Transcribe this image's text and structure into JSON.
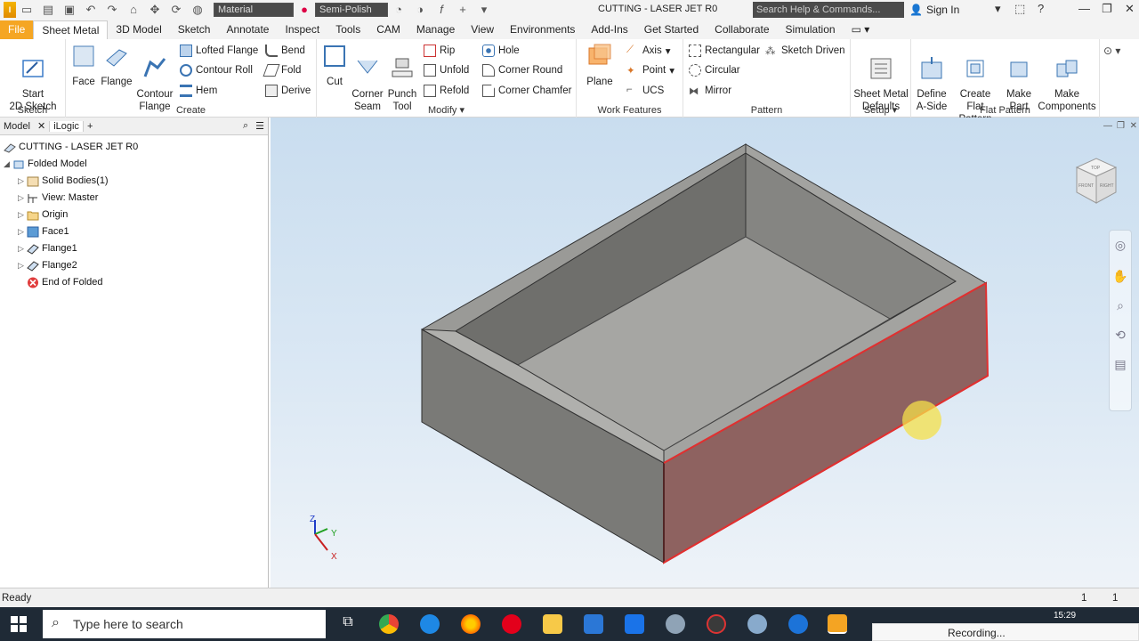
{
  "app": {
    "title": "CUTTING - LASER JET R0",
    "material_placeholder": "Material",
    "appearance": "Semi-Polish",
    "search_placeholder": "Search Help & Commands...",
    "signin": "Sign In"
  },
  "tabs": [
    "File",
    "Sheet Metal",
    "3D Model",
    "Sketch",
    "Annotate",
    "Inspect",
    "Tools",
    "CAM",
    "Manage",
    "View",
    "Environments",
    "Add-Ins",
    "Get Started",
    "Collaborate",
    "Simulation"
  ],
  "ribbon": {
    "sketch": {
      "title": "Sketch",
      "start_2d": "Start\n2D Sketch"
    },
    "create": {
      "title": "Create",
      "face": "Face",
      "flange": "Flange",
      "contour_flange": "Contour\nFlange",
      "lofted_flange": "Lofted Flange",
      "contour_roll": "Contour Roll",
      "hem": "Hem",
      "bend": "Bend",
      "fold": "Fold",
      "derive": "Derive"
    },
    "modify": {
      "title": "Modify",
      "cut": "Cut",
      "corner_seam": "Corner\nSeam",
      "punch_tool": "Punch\nTool",
      "rip": "Rip",
      "unfold": "Unfold",
      "refold": "Refold",
      "hole": "Hole",
      "corner_round": "Corner Round",
      "corner_chamfer": "Corner Chamfer"
    },
    "work_features": {
      "title": "Work Features",
      "plane": "Plane",
      "axis": "Axis",
      "point": "Point",
      "ucs": "UCS"
    },
    "pattern": {
      "title": "Pattern",
      "rectangular": "Rectangular",
      "circular": "Circular",
      "mirror": "Mirror",
      "sketch_driven": "Sketch Driven"
    },
    "setup": {
      "title": "Setup",
      "defaults": "Sheet Metal\nDefaults"
    },
    "flat_pattern": {
      "title": "Flat Pattern",
      "define_a_side": "Define\nA-Side",
      "create_flat": "Create\nFlat Pattern",
      "make_part": "Make\nPart",
      "make_components": "Make\nComponents"
    }
  },
  "browser": {
    "tab_model": "Model",
    "tab_ilogic": "iLogic",
    "root": "CUTTING - LASER JET R0",
    "items": [
      {
        "label": "Folded Model"
      },
      {
        "label": "Solid Bodies(1)"
      },
      {
        "label": "View: Master"
      },
      {
        "label": "Origin"
      },
      {
        "label": "Face1"
      },
      {
        "label": "Flange1"
      },
      {
        "label": "Flange2"
      },
      {
        "label": "End of Folded"
      }
    ]
  },
  "viewcube": {
    "front": "FRONT",
    "right": "RIGHT",
    "top": "TOP"
  },
  "triad": {
    "x": "X",
    "y": "Y",
    "z": "Z"
  },
  "status": {
    "text": "Ready",
    "count1": "1",
    "count2": "1"
  },
  "taskbar": {
    "search": "Type here to search",
    "time": "15:29",
    "recording": "Recording..."
  }
}
